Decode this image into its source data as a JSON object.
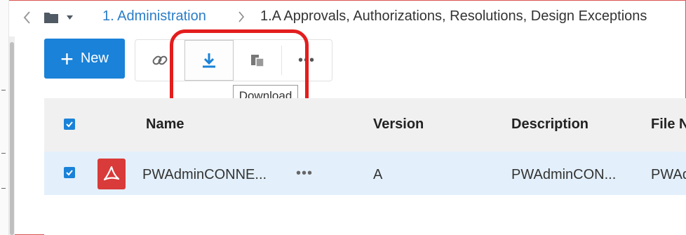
{
  "breadcrumb": {
    "level1": "1. Administration",
    "level2": "1.A Approvals, Authorizations, Resolutions, Design Exceptions"
  },
  "toolbar": {
    "new_plus": "+",
    "new_label": "New",
    "more_label": "•••",
    "tooltip": "Download"
  },
  "table": {
    "columns": [
      "Name",
      "Version",
      "Description",
      "File N"
    ],
    "rows": [
      {
        "selected": true,
        "icon": "pdf-icon",
        "name": "PWAdminCONNE...",
        "more": "•••",
        "version": "A",
        "description": "PWAdminCON...",
        "file_name": "PWAd"
      }
    ]
  },
  "colors": {
    "accent": "#1a82d8",
    "highlight": "#e41d1d",
    "selected_row": "#e3f0fb",
    "pdf": "#d93a3a"
  },
  "icons": {
    "back": "chevron-left-icon",
    "folder": "folder-icon",
    "link": "link-icon",
    "download": "download-icon",
    "copy": "copy-icon",
    "checkbox": "checkbox-checked-icon"
  }
}
